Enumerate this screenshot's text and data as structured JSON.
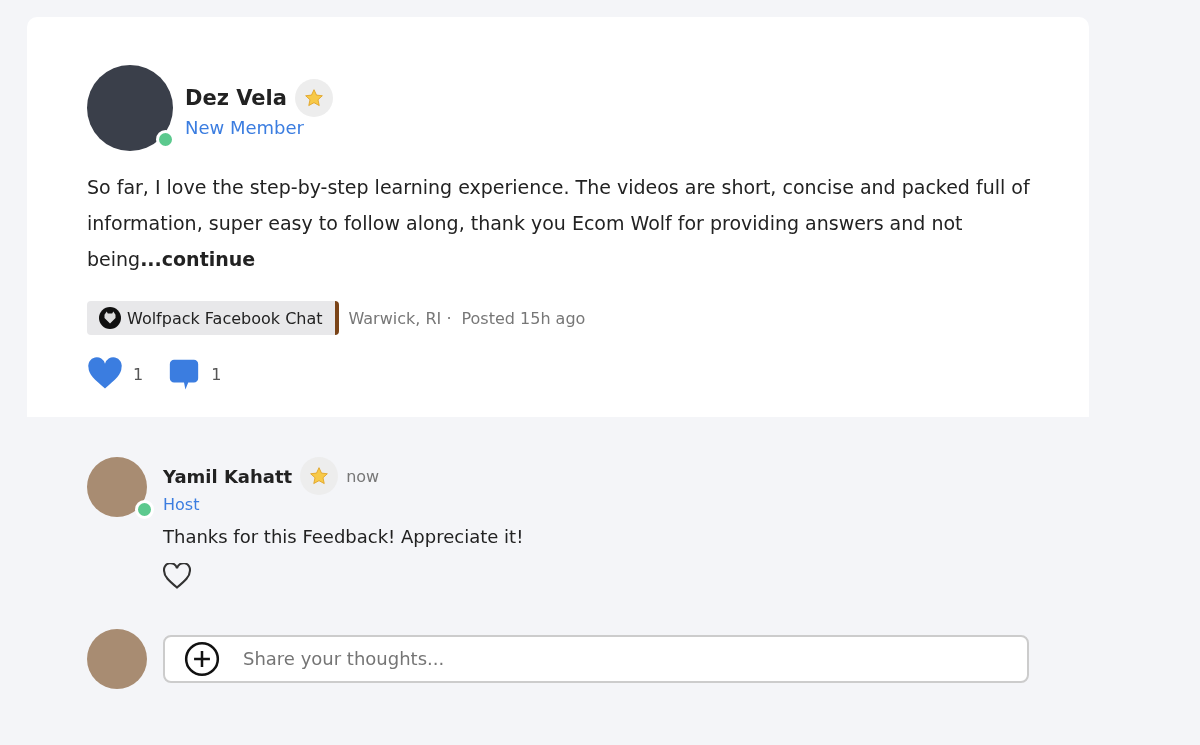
{
  "post": {
    "author": {
      "name": "Dez Vela",
      "role": "New Member",
      "online": true,
      "starred": true
    },
    "body": "So far, I love the step-by-step learning experience. The videos are short, concise and packed full of information, super easy to follow along, thank you Ecom Wolf for providing answers and not being**...continue**",
    "channel": {
      "label": "Wolfpack Facebook Chat",
      "color": "#7a4418"
    },
    "location": "Warwick, RI ·",
    "posted": "Posted 15h ago",
    "likes": {
      "count": "1",
      "liked": true
    },
    "comments": {
      "count": "1"
    }
  },
  "replies": [
    {
      "name": "Yamil Kahatt",
      "role": "Host",
      "online": true,
      "starred": true,
      "time": "now",
      "text": "Thanks for this Feedback! Appreciate it!",
      "liked": false
    }
  ],
  "composer": {
    "placeholder": "Share your thoughts..."
  }
}
